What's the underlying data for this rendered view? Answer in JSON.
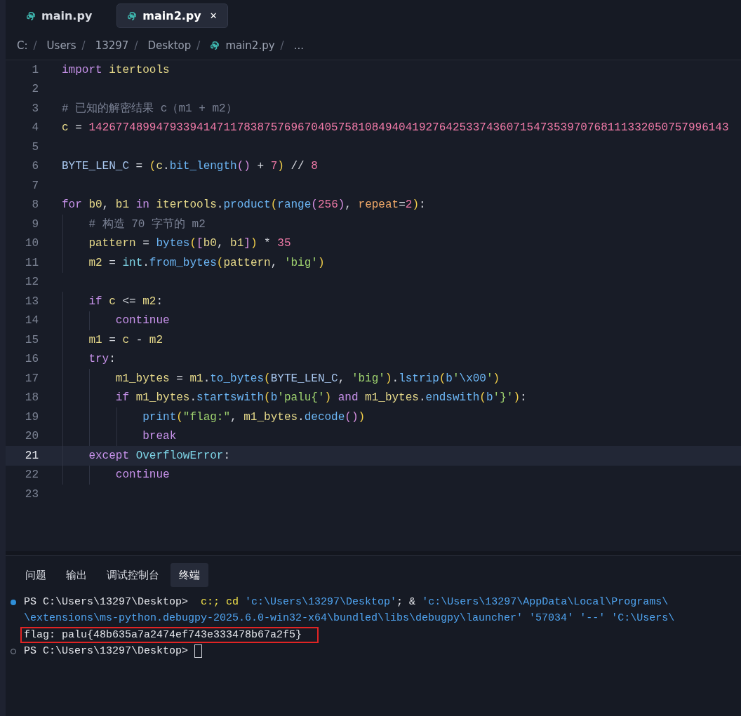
{
  "tabs": [
    {
      "label": "main.py",
      "selected": false
    },
    {
      "label": "main2.py",
      "selected": true,
      "close": "✕"
    }
  ],
  "breadcrumbs": [
    {
      "label": "C:",
      "sep": "/",
      "kind": "folder"
    },
    {
      "label": "Users",
      "sep": "/",
      "kind": "folder"
    },
    {
      "label": "13297",
      "sep": "/",
      "kind": "folder"
    },
    {
      "label": "Desktop",
      "sep": "/",
      "kind": "folder"
    },
    {
      "label": "main2.py",
      "sep": "/",
      "kind": "file"
    },
    {
      "label": "...",
      "kind": "more"
    }
  ],
  "editor": {
    "lines": [
      {
        "number": "1",
        "current": false,
        "tokens": [
          {
            "kind": "kw",
            "text": "import "
          },
          {
            "kind": "var",
            "text": "itertools"
          }
        ]
      },
      {
        "number": "2",
        "current": false
      },
      {
        "number": "3",
        "current": false,
        "tokens": [
          {
            "kind": "cm",
            "text": "# 已知的解密结果 c（m1 + m2）"
          }
        ]
      },
      {
        "number": "4",
        "current": false,
        "tokens": [
          {
            "kind": "var",
            "text": "c"
          },
          {
            "kind": "op",
            "text": " = "
          },
          {
            "kind": "num",
            "text": "14267748994793394147117838757696704057581084940419276425337436071547353970768111332050757996143"
          }
        ]
      },
      {
        "number": "5",
        "current": false
      },
      {
        "number": "6",
        "current": false,
        "tokens": [
          {
            "kind": "const",
            "text": "BYTE_LEN_C"
          },
          {
            "kind": "op",
            "text": " = "
          },
          {
            "kind": "br",
            "text": "("
          },
          {
            "kind": "var",
            "text": "c"
          },
          {
            "kind": "op",
            "text": "."
          },
          {
            "kind": "fn",
            "text": "bit_length"
          },
          {
            "kind": "br2",
            "text": "()"
          },
          {
            "kind": "op",
            "text": " + "
          },
          {
            "kind": "num",
            "text": "7"
          },
          {
            "kind": "br",
            "text": ")"
          },
          {
            "kind": "op",
            "text": " // "
          },
          {
            "kind": "num",
            "text": "8"
          }
        ]
      },
      {
        "number": "7",
        "current": false
      },
      {
        "number": "8",
        "current": false,
        "tokens": [
          {
            "kind": "kw",
            "text": "for "
          },
          {
            "kind": "var",
            "text": "b0"
          },
          {
            "kind": "op",
            "text": ", "
          },
          {
            "kind": "var",
            "text": "b1 "
          },
          {
            "kind": "kw",
            "text": "in "
          },
          {
            "kind": "var",
            "text": "itertools"
          },
          {
            "kind": "op",
            "text": "."
          },
          {
            "kind": "fn",
            "text": "product"
          },
          {
            "kind": "br",
            "text": "("
          },
          {
            "kind": "fn",
            "text": "range"
          },
          {
            "kind": "br2",
            "text": "("
          },
          {
            "kind": "num",
            "text": "256"
          },
          {
            "kind": "br2",
            "text": ")"
          },
          {
            "kind": "op",
            "text": ", "
          },
          {
            "kind": "param",
            "text": "repeat"
          },
          {
            "kind": "op",
            "text": "="
          },
          {
            "kind": "num",
            "text": "2"
          },
          {
            "kind": "br",
            "text": ")"
          },
          {
            "kind": "op",
            "text": ":"
          }
        ]
      },
      {
        "number": "9",
        "current": false,
        "tokens": [
          {
            "kind": "cm",
            "text": "    # 构造 70 字节的 m2"
          }
        ]
      },
      {
        "number": "10",
        "current": false,
        "tokens": [
          {
            "kind": "var",
            "text": "    pattern"
          },
          {
            "kind": "op",
            "text": " = "
          },
          {
            "kind": "fn",
            "text": "bytes"
          },
          {
            "kind": "br",
            "text": "("
          },
          {
            "kind": "br2",
            "text": "["
          },
          {
            "kind": "var",
            "text": "b0"
          },
          {
            "kind": "op",
            "text": ", "
          },
          {
            "kind": "var",
            "text": "b1"
          },
          {
            "kind": "br2",
            "text": "]"
          },
          {
            "kind": "br",
            "text": ")"
          },
          {
            "kind": "op",
            "text": " * "
          },
          {
            "kind": "num",
            "text": "35"
          }
        ]
      },
      {
        "number": "11",
        "current": false,
        "tokens": [
          {
            "kind": "var",
            "text": "    m2"
          },
          {
            "kind": "op",
            "text": " = "
          },
          {
            "kind": "cls",
            "text": "int"
          },
          {
            "kind": "op",
            "text": "."
          },
          {
            "kind": "fn",
            "text": "from_bytes"
          },
          {
            "kind": "br",
            "text": "("
          },
          {
            "kind": "var",
            "text": "pattern"
          },
          {
            "kind": "op",
            "text": ", "
          },
          {
            "kind": "str",
            "text": "'big'"
          },
          {
            "kind": "br",
            "text": ")"
          }
        ]
      },
      {
        "number": "12",
        "current": false
      },
      {
        "number": "13",
        "current": false,
        "tokens": [
          {
            "kind": "kw",
            "text": "    if "
          },
          {
            "kind": "var",
            "text": "c"
          },
          {
            "kind": "op",
            "text": " <= "
          },
          {
            "kind": "var",
            "text": "m2"
          },
          {
            "kind": "op",
            "text": ":"
          }
        ]
      },
      {
        "number": "14",
        "current": false,
        "tokens": [
          {
            "kind": "kw",
            "text": "        continue"
          }
        ]
      },
      {
        "number": "15",
        "current": false,
        "tokens": [
          {
            "kind": "var",
            "text": "    m1"
          },
          {
            "kind": "op",
            "text": " = "
          },
          {
            "kind": "var",
            "text": "c"
          },
          {
            "kind": "op",
            "text": " - "
          },
          {
            "kind": "var",
            "text": "m2"
          }
        ]
      },
      {
        "number": "16",
        "current": false,
        "tokens": [
          {
            "kind": "kw",
            "text": "    try"
          },
          {
            "kind": "op",
            "text": ":"
          }
        ]
      },
      {
        "number": "17",
        "current": false,
        "tokens": [
          {
            "kind": "var",
            "text": "        m1_bytes"
          },
          {
            "kind": "op",
            "text": " = "
          },
          {
            "kind": "var",
            "text": "m1"
          },
          {
            "kind": "op",
            "text": "."
          },
          {
            "kind": "fn",
            "text": "to_bytes"
          },
          {
            "kind": "br",
            "text": "("
          },
          {
            "kind": "const",
            "text": "BYTE_LEN_C"
          },
          {
            "kind": "op",
            "text": ", "
          },
          {
            "kind": "str",
            "text": "'big'"
          },
          {
            "kind": "br",
            "text": ")"
          },
          {
            "kind": "op",
            "text": "."
          },
          {
            "kind": "fn",
            "text": "lstrip"
          },
          {
            "kind": "br",
            "text": "("
          },
          {
            "kind": "fn",
            "text": "b"
          },
          {
            "kind": "str",
            "text": "'"
          },
          {
            "kind": "esc",
            "text": "\\x00"
          },
          {
            "kind": "str",
            "text": "'"
          },
          {
            "kind": "br",
            "text": ")"
          }
        ]
      },
      {
        "number": "18",
        "current": false,
        "tokens": [
          {
            "kind": "kw",
            "text": "        if "
          },
          {
            "kind": "var",
            "text": "m1_bytes"
          },
          {
            "kind": "op",
            "text": "."
          },
          {
            "kind": "fn",
            "text": "startswith"
          },
          {
            "kind": "br",
            "text": "("
          },
          {
            "kind": "fn",
            "text": "b"
          },
          {
            "kind": "str",
            "text": "'palu{'"
          },
          {
            "kind": "br",
            "text": ") "
          },
          {
            "kind": "kw",
            "text": "and "
          },
          {
            "kind": "var",
            "text": "m1_bytes"
          },
          {
            "kind": "op",
            "text": "."
          },
          {
            "kind": "fn",
            "text": "endswith"
          },
          {
            "kind": "br",
            "text": "("
          },
          {
            "kind": "fn",
            "text": "b"
          },
          {
            "kind": "str",
            "text": "'}'"
          },
          {
            "kind": "br",
            "text": ")"
          },
          {
            "kind": "op",
            "text": ":"
          }
        ]
      },
      {
        "number": "19",
        "current": false,
        "tokens": [
          {
            "kind": "fn",
            "text": "            print"
          },
          {
            "kind": "br",
            "text": "("
          },
          {
            "kind": "str",
            "text": "\"flag:\""
          },
          {
            "kind": "op",
            "text": ", "
          },
          {
            "kind": "var",
            "text": "m1_bytes"
          },
          {
            "kind": "op",
            "text": "."
          },
          {
            "kind": "fn",
            "text": "decode"
          },
          {
            "kind": "br2",
            "text": "()"
          },
          {
            "kind": "br",
            "text": ")"
          }
        ]
      },
      {
        "number": "20",
        "current": false,
        "tokens": [
          {
            "kind": "kw",
            "text": "            break"
          }
        ]
      },
      {
        "number": "21",
        "current": true,
        "tokens": [
          {
            "kind": "kw",
            "text": "    except "
          },
          {
            "kind": "cls",
            "text": "OverflowError"
          },
          {
            "kind": "op",
            "text": ":"
          }
        ]
      },
      {
        "number": "22",
        "current": false,
        "tokens": [
          {
            "kind": "kw",
            "text": "        continue"
          }
        ]
      },
      {
        "number": "23",
        "current": false
      }
    ]
  },
  "panel_tabs": [
    {
      "label": "问题",
      "selected": false
    },
    {
      "label": "输出",
      "selected": false
    },
    {
      "label": "调试控制台",
      "selected": false
    },
    {
      "label": "终端",
      "selected": true
    }
  ],
  "terminal": [
    {
      "kind": "dot",
      "highlighted": false,
      "cursor": false,
      "tokens": [
        {
          "kind": "plain",
          "text": "PS C:\\Users\\13297\\Desktop>  "
        },
        {
          "kind": "cmd",
          "text": "c:; cd "
        },
        {
          "kind": "path",
          "text": "'c:\\Users\\13297\\Desktop'"
        },
        {
          "kind": "plain",
          "text": "; & "
        },
        {
          "kind": "path",
          "text": "'c:\\Users\\13297\\AppData\\Local\\Programs\\"
        }
      ]
    },
    {
      "kind": "plain",
      "highlighted": false,
      "cursor": false,
      "tokens": [
        {
          "kind": "path",
          "text": "\\extensions\\ms-python.debugpy-2025.6.0-win32-x64\\bundled\\libs\\debugpy\\launcher' '57034' '--' 'C:\\Users\\"
        }
      ]
    },
    {
      "kind": "plain",
      "highlighted": true,
      "cursor": false,
      "tokens": [
        {
          "kind": "plain",
          "text": "flag: palu{48b635a7a2474ef743e333478b67a2f5}"
        }
      ]
    },
    {
      "kind": "ring",
      "highlighted": false,
      "cursor": true,
      "tokens": [
        {
          "kind": "plain",
          "text": "PS C:\\Users\\13297\\Desktop> "
        }
      ]
    }
  ]
}
